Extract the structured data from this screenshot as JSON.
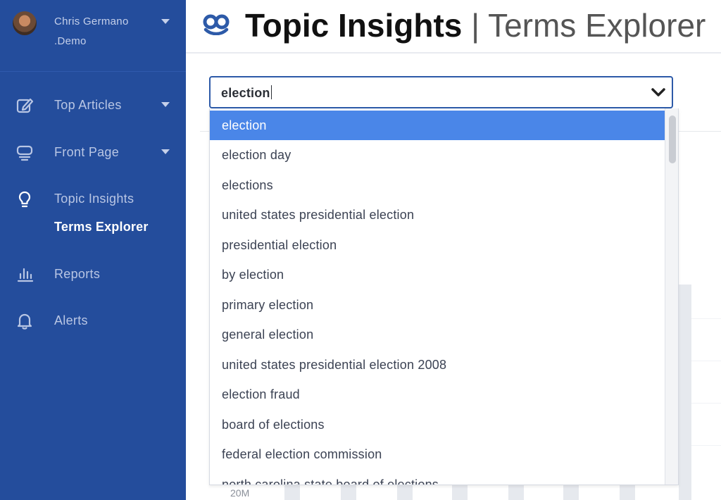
{
  "user": {
    "name": "Chris Germano",
    "org": ".Demo"
  },
  "nav": {
    "top_articles": "Top Articles",
    "front_page": "Front Page",
    "topic_insights": "Topic Insights",
    "terms_explorer": "Terms Explorer",
    "reports": "Reports",
    "alerts": "Alerts"
  },
  "header": {
    "title": "Topic Insights",
    "separator": "|",
    "subtitle": "Terms Explorer"
  },
  "search": {
    "value": "election"
  },
  "suggestions": [
    "election",
    "election day",
    "elections",
    "united states presidential election",
    "presidential election",
    "by election",
    "primary election",
    "general election",
    "united states presidential election 2008",
    "election fraud",
    "board of elections",
    "federal election commission",
    "north carolina state board of elections"
  ],
  "chart": {
    "axis_label": "20M"
  },
  "colors": {
    "sidebar": "#244d9c",
    "accent": "#2d5aa8",
    "highlight": "#4a86e8"
  }
}
